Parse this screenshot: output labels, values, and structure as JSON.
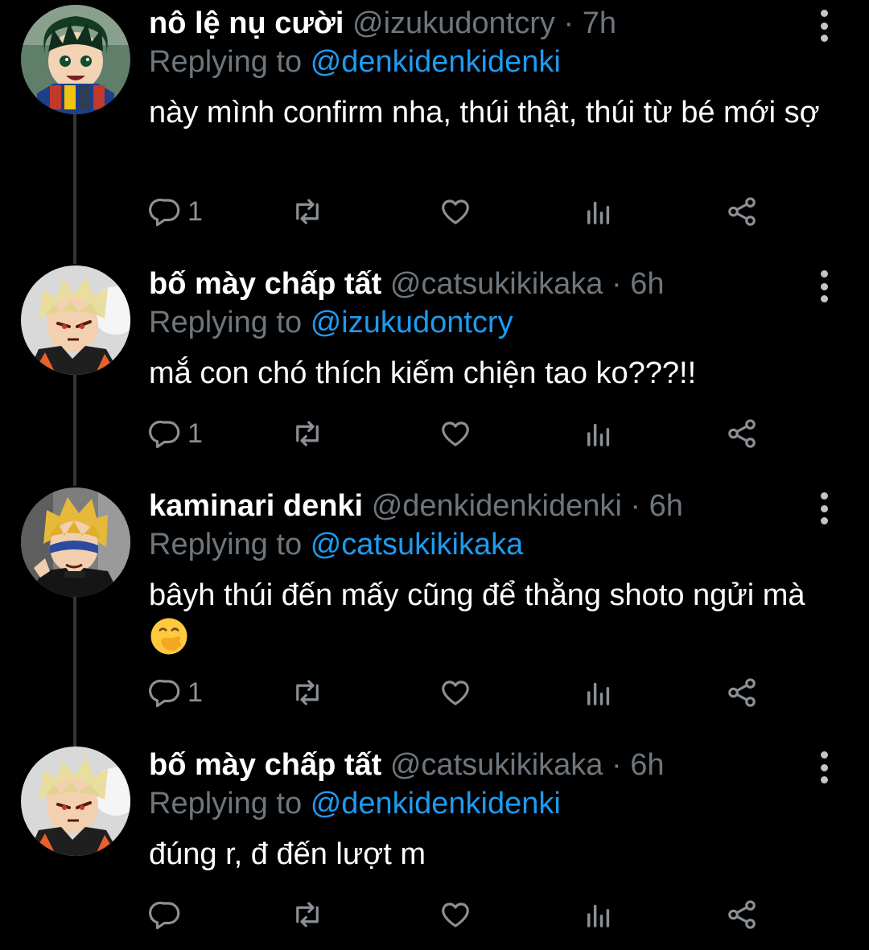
{
  "tweets": [
    {
      "name": "nô lệ nụ cười",
      "handle": "@izukudontcry",
      "separator": "·",
      "time": "7h",
      "replying_prefix": "Replying to",
      "replying_to": "@denkidenkidenki",
      "text": "này mình confirm nha, thúi thật, thúi từ bé mới sợ",
      "reply_count": "1",
      "avatar": "izuku-avatar"
    },
    {
      "name": "bố mày chấp tất",
      "handle": "@catsukikikaka",
      "separator": "·",
      "time": "6h",
      "replying_prefix": "Replying to",
      "replying_to": "@izukudontcry",
      "text": "mắ con chó thích kiếm chiện tao ko???!!",
      "reply_count": "1",
      "avatar": "bakugo-avatar"
    },
    {
      "name": "kaminari denki",
      "handle": "@denkidenkidenki",
      "separator": "·",
      "time": "6h",
      "replying_prefix": "Replying to",
      "replying_to": "@catsukikikaka",
      "text": "bâyh thúi đến mấy cũng để thằng shoto ngửi mà",
      "emoji": "face-with-hand-over-mouth",
      "reply_count": "1",
      "avatar": "kaminari-avatar"
    },
    {
      "name": "bố mày chấp tất",
      "handle": "@catsukikikaka",
      "separator": "·",
      "time": "6h",
      "replying_prefix": "Replying to",
      "replying_to": "@denkidenkidenki",
      "text": "đúng r, đ đến lượt m",
      "reply_count": "",
      "avatar": "bakugo-avatar"
    }
  ],
  "colors": {
    "background": "#000000",
    "secondary_text": "#6e767d",
    "mention": "#1d9bf0",
    "thread_line": "#333639",
    "icon": "#8b9096"
  },
  "icons": [
    "reply-icon",
    "retweet-icon",
    "like-icon",
    "analytics-icon",
    "share-icon",
    "more-icon"
  ]
}
